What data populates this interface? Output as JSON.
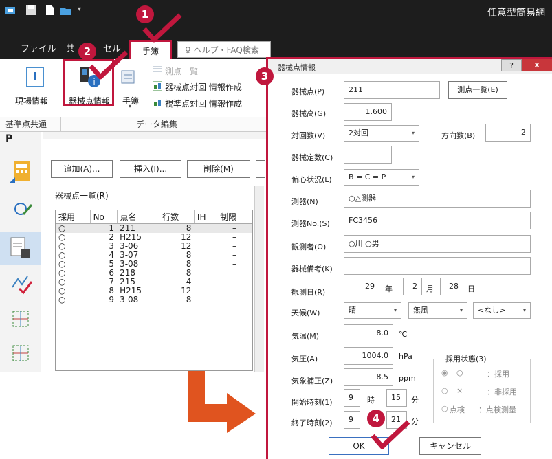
{
  "app": {
    "title": "任意型簡易網"
  },
  "tabs": {
    "file": "ファイル",
    "common": "共",
    "sel": "セル",
    "techo": "手簿",
    "help": "ヘルプ・FAQ検索"
  },
  "ribbon": {
    "genba": "現場情報",
    "kikaiten": "器械点情報",
    "techo": "手簿",
    "sokuten_ichiran": "測点一覧",
    "kikaiten_taisen": "器械点対回 情報作成",
    "shijunten_taisen": "視準点対回 情報作成",
    "group_kijun": "基準点共通",
    "group_data": "データ編集"
  },
  "main": {
    "add_button": "追加(A)...",
    "insert_button": "挿入(I)...",
    "delete_button": "削除(M)",
    "list_title": "器械点一覧(R)",
    "columns": [
      "採用",
      "No",
      "点名",
      "行数",
      "IH",
      "制限"
    ],
    "rows": [
      [
        "○",
        "1",
        "211",
        "8",
        "",
        "–"
      ],
      [
        "○",
        "2",
        "H215",
        "12",
        "",
        "–"
      ],
      [
        "○",
        "3",
        "3-06",
        "12",
        "",
        "–"
      ],
      [
        "○",
        "4",
        "3-07",
        "8",
        "",
        "–"
      ],
      [
        "○",
        "5",
        "3-08",
        "8",
        "",
        "–"
      ],
      [
        "○",
        "6",
        "218",
        "8",
        "",
        "–"
      ],
      [
        "○",
        "7",
        "215",
        "4",
        "",
        "–"
      ],
      [
        "○",
        "8",
        "H215",
        "12",
        "",
        "–"
      ],
      [
        "○",
        "9",
        "3-08",
        "8",
        "",
        "–"
      ]
    ]
  },
  "dialog": {
    "title": "器械点情報",
    "help_btn": "?",
    "close_btn": "x",
    "kikaiten_label": "器械点(P)",
    "kikaiten_value": "211",
    "sokuten_button": "測点一覧(E)",
    "kikaidaka_label": "器械高(G)",
    "kikaidaka_value": "1.600",
    "taikai_label": "対回数(V)",
    "taikai_value": "2対回",
    "houkou_label": "方向数(B)",
    "houkou_value": "2",
    "teisu_label": "器械定数(C)",
    "teisu_value": "",
    "henshin_label": "偏心状況(L)",
    "henshin_value": "B = C = P",
    "sokki_label": "測器(N)",
    "sokki_value": "○△測器",
    "sokki_no_label": "測器No.(S)",
    "sokki_no_value": "FC3456",
    "kansoku_label": "観測者(O)",
    "kansoku_value": "○川 ○男",
    "biko_label": "器械備考(K)",
    "biko_value": "",
    "date_label": "観測日(R)",
    "year_value": "29",
    "year_unit": "年",
    "month_value": "2",
    "month_unit": "月",
    "day_value": "28",
    "day_unit": "日",
    "weather_label": "天候(W)",
    "weather_value": "晴",
    "wind_value": "無風",
    "other_value": "<なし>",
    "temp_label": "気温(M)",
    "temp_value": "8.0",
    "temp_unit": "℃",
    "pressure_label": "気圧(A)",
    "pressure_value": "1004.0",
    "pressure_unit": "hPa",
    "correction_label": "気象補正(Z)",
    "correction_value": "8.5",
    "correction_unit": "ppm",
    "start_label": "開始時刻(1)",
    "start_hour": "9",
    "hour_unit": "時",
    "start_min": "15",
    "min_unit": "分",
    "end_label": "終了時刻(2)",
    "end_hour": "9",
    "end_min": "21",
    "status_group": "採用状態(3)",
    "status_opt1_mark": "○",
    "status_opt1_text": "：採用",
    "status_opt2_mark": "×",
    "status_opt2_text": "：非採用",
    "status_opt3_mark": "点検",
    "status_opt3_text": "：点検測量",
    "ok_button": "OK",
    "cancel_button": "キャンセル"
  },
  "markers": {
    "m1": "1",
    "m2": "2",
    "m3": "3",
    "m4": "4"
  },
  "colors": {
    "marker": "#c0173d",
    "check": "#c0173d",
    "arrow": "#e0541f",
    "titlebar": "#1d1d1d"
  }
}
